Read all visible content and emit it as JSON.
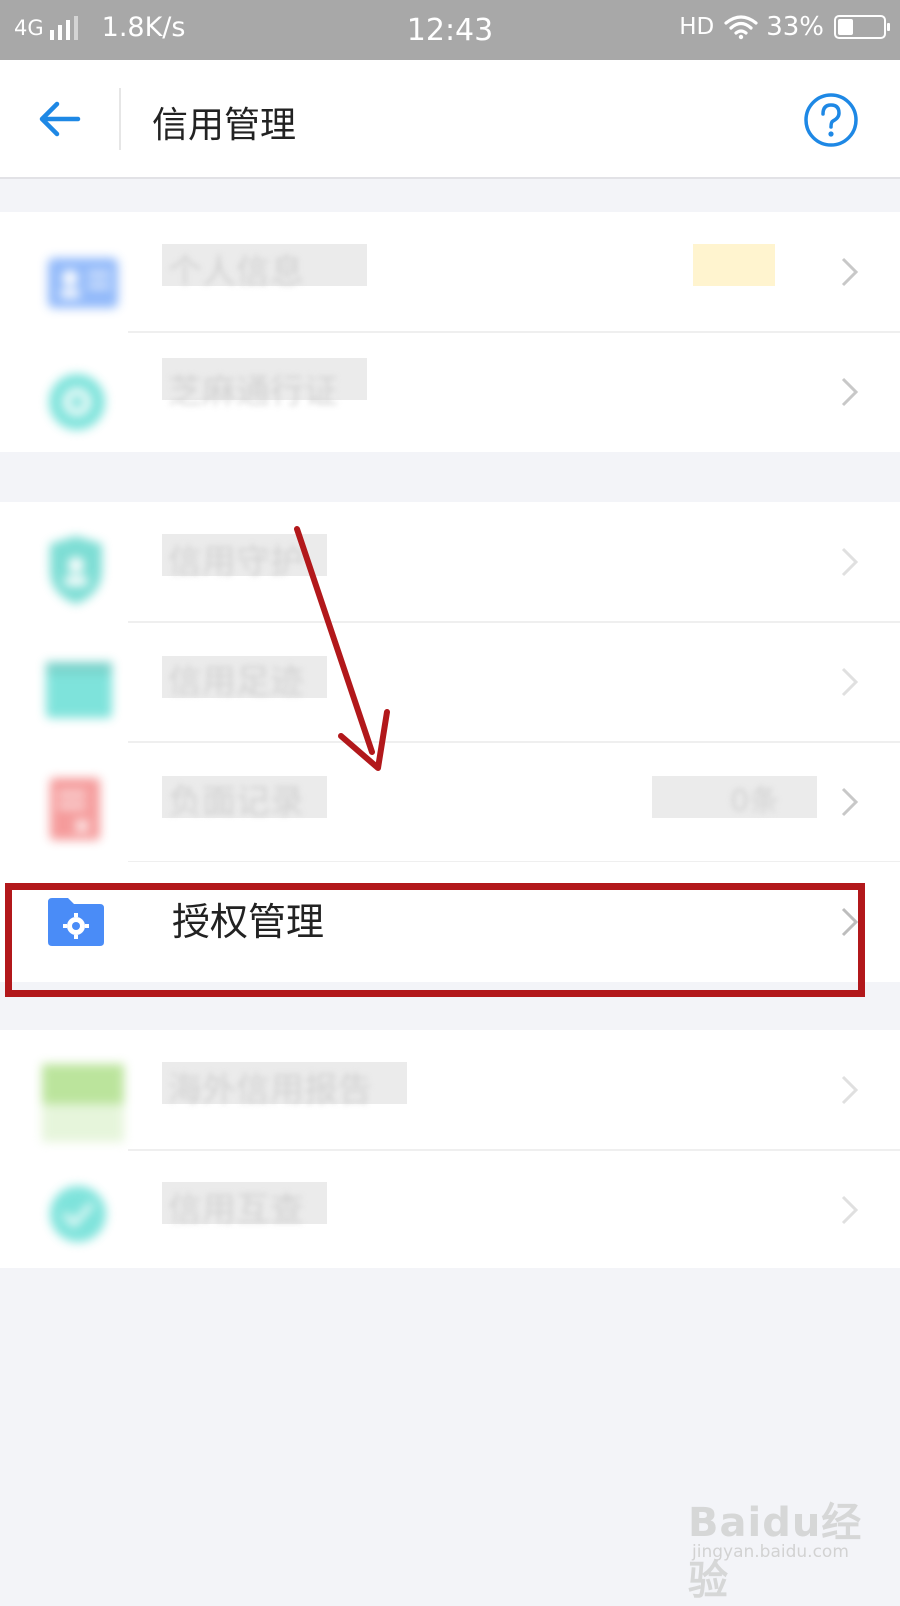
{
  "status_bar": {
    "network": "4G",
    "speed": "1.8K/s",
    "time": "12:43",
    "hd": "HD",
    "battery": "33%",
    "battery_level": 0.33
  },
  "header": {
    "title": "信用管理",
    "back_icon": "back-arrow-icon",
    "help_icon": "help-icon"
  },
  "groups": [
    {
      "items": [
        {
          "label": "个人信息",
          "icon": "id-card-icon",
          "icon_color": "#4a8cf7"
        },
        {
          "label": "芝麻通行证",
          "icon": "badge-icon",
          "icon_color": "#2ad1c4"
        }
      ]
    },
    {
      "items": [
        {
          "label": "信用守护",
          "icon": "shield-user-icon",
          "icon_color": "#26c7b8"
        },
        {
          "label": "信用足迹",
          "icon": "calendar-icon",
          "icon_color": "#2ad1c4"
        },
        {
          "label": "负面记录",
          "icon": "record-icon",
          "icon_color": "#ef5a5a",
          "value": "0条"
        },
        {
          "label": "授权管理",
          "icon": "folder-gear-icon",
          "icon_color": "#4a8cf7"
        }
      ]
    },
    {
      "items": [
        {
          "label": "海外信用报告",
          "icon": "globe-icon",
          "icon_color": "#8fd35c"
        },
        {
          "label": "信用互查",
          "icon": "check-icon",
          "icon_color": "#2ad1c4"
        }
      ]
    }
  ],
  "annotation": {
    "highlight_color": "#b2181b"
  },
  "watermark": {
    "main": "Baidu经验",
    "sub": "jingyan.baidu.com"
  }
}
